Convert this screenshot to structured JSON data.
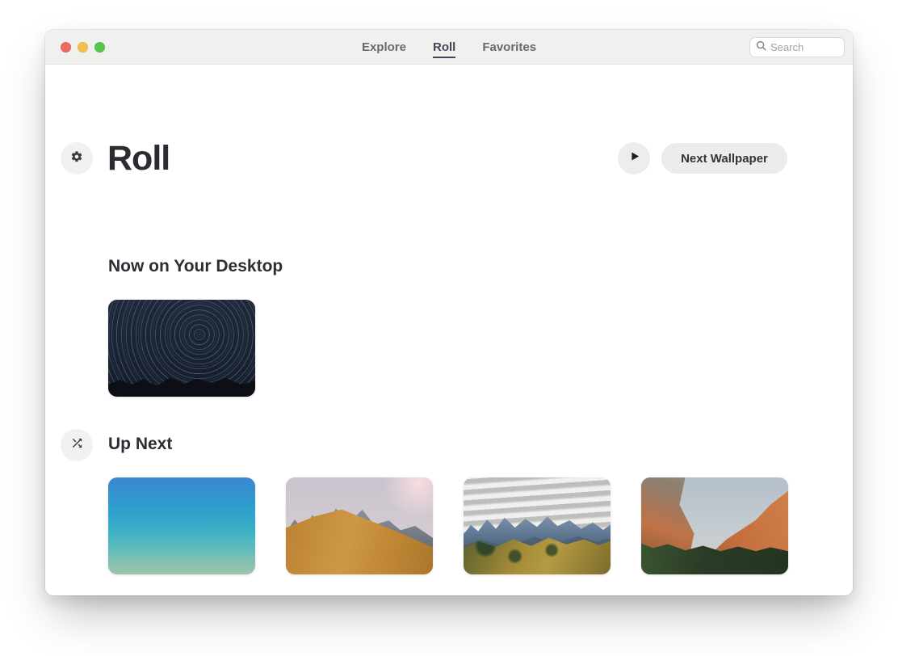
{
  "titlebar": {
    "tabs": [
      {
        "label": "Explore",
        "active": false
      },
      {
        "label": "Roll",
        "active": true
      },
      {
        "label": "Favorites",
        "active": false
      }
    ],
    "search": {
      "placeholder": "Search",
      "icon": "search-icon"
    },
    "traffic_lights": {
      "close_color": "#ED6A5E",
      "minimize_color": "#F4BF4F",
      "zoom_color": "#55C64A"
    }
  },
  "header": {
    "title": "Roll",
    "title_icon": "gear-icon",
    "play_icon": "play-icon",
    "next_wallpaper_label": "Next Wallpaper"
  },
  "sections": {
    "now_on_desktop": {
      "heading": "Now on Your Desktop",
      "wallpaper": {
        "name": "star-trails-night-sky-over-mountains"
      }
    },
    "up_next": {
      "heading": "Up Next",
      "icon": "shuffle-icon",
      "wallpapers": [
        {
          "name": "blue-ocean-gradient"
        },
        {
          "name": "golden-hillside-rocky-peaks"
        },
        {
          "name": "autumn-alpine-mountain-valley"
        },
        {
          "name": "sunlit-red-canyon-cliffs"
        }
      ]
    }
  },
  "colors": {
    "titlebar_bg": "#F0F0EF",
    "active_tab": "#45455A",
    "inactive_tab": "#696972",
    "heading_text": "#2D2D33",
    "button_bg": "#ECECEB",
    "badge_bg": "#F1F1F0"
  }
}
